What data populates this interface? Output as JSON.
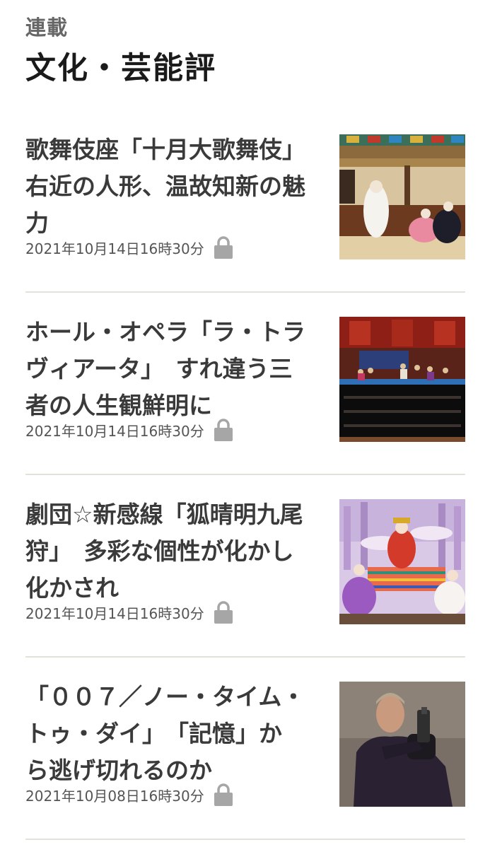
{
  "header": {
    "series_label": "連載",
    "title": "文化・芸能評"
  },
  "articles": [
    {
      "title": "歌舞伎座「十月大歌舞伎」\n右近の人形、温故知新の魅\n力",
      "date": "2021年10月14日16時30分",
      "locked": true,
      "thumb": "kabuki-stage-photo"
    },
    {
      "title": "ホール・オペラ「ラ・トラ\nヴィアータ」　すれ違う三\n者の人生観鮮明に",
      "date": "2021年10月14日16時30分",
      "locked": true,
      "thumb": "opera-stage-photo"
    },
    {
      "title": "劇団☆新感線「狐晴明九尾\n狩」　多彩な個性が化かし\n化かされ",
      "date": "2021年10月14日16時30分",
      "locked": true,
      "thumb": "theater-stage-photo"
    },
    {
      "title": "「００７／ノー・タイム・\nトゥ・ダイ」　「記憶」か\nら逃げ切れるのか",
      "date": "2021年10月08日16時30分",
      "locked": true,
      "thumb": "film-still-photo"
    }
  ],
  "icons": {
    "lock": "lock-icon"
  },
  "colors": {
    "title": "#1a1a1a",
    "article_title": "#3a3a3a",
    "date": "#555555",
    "divider": "#e3e1dc",
    "lock": "#a6a6a6"
  }
}
